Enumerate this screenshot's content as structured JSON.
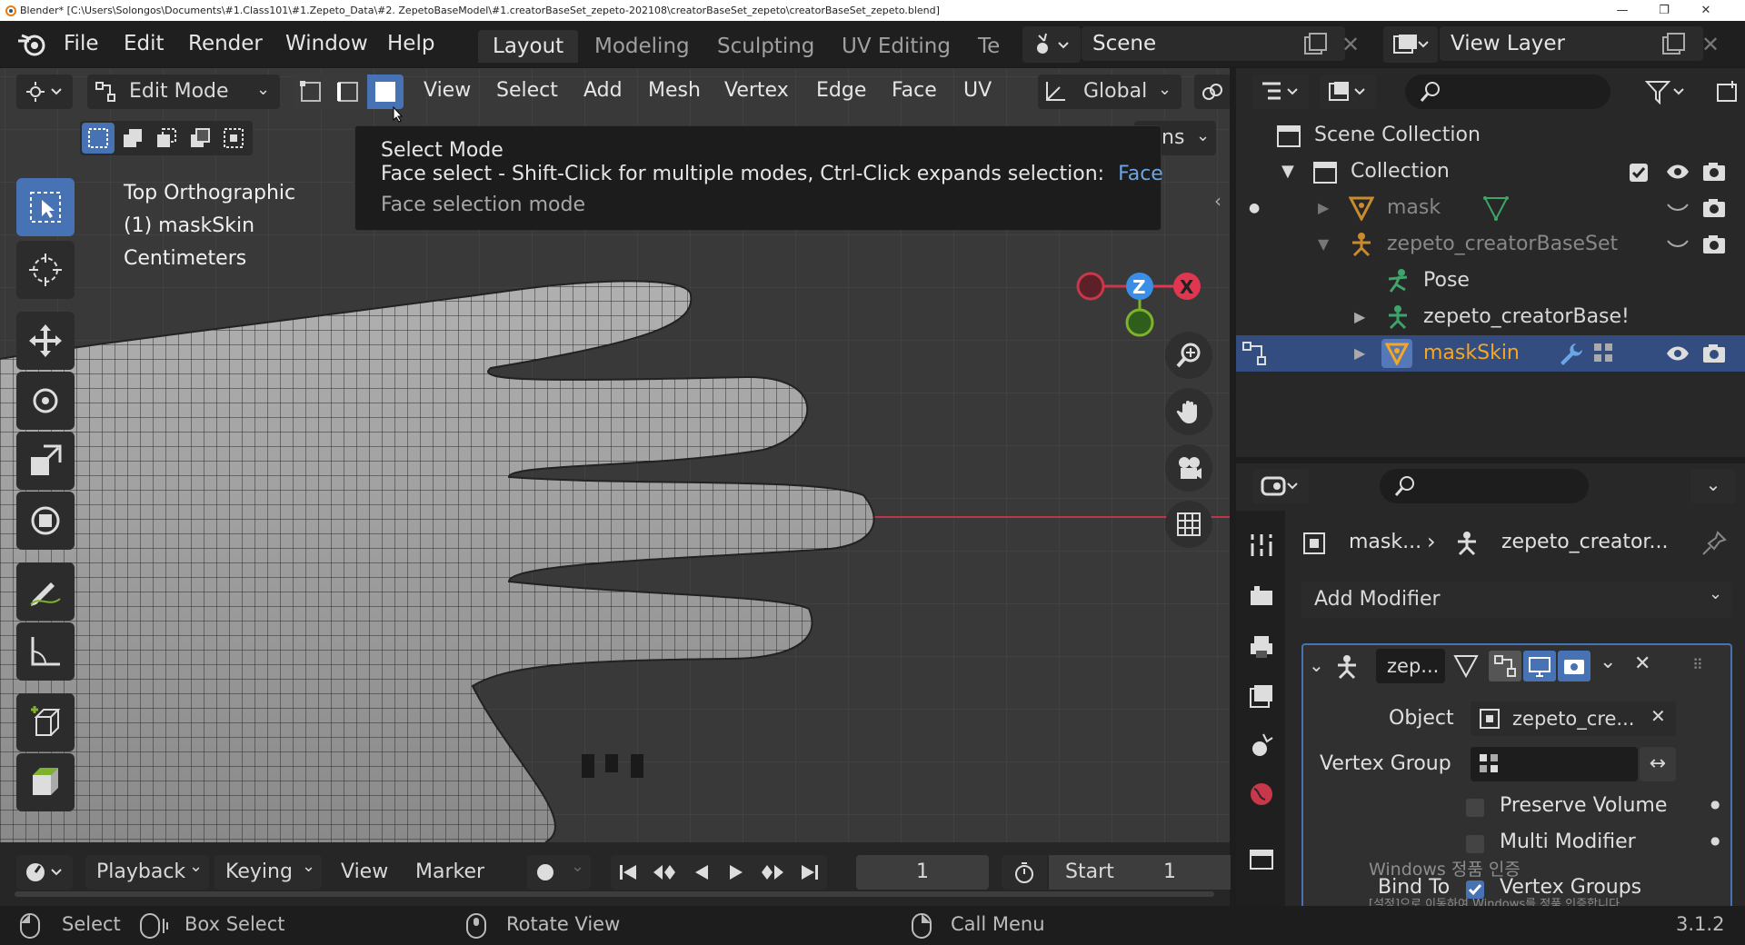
{
  "titlebar": {
    "title": "Blender* [C:\\Users\\Solongos\\Documents\\#1.Class101\\#1.Zepeto_Data\\#2. ZepetoBaseModel\\#1.creatorBaseSet_zepeto-202108\\creatorBaseSet_zepeto\\creatorBaseSet_zepeto.blend]"
  },
  "menu": {
    "file": "File",
    "edit": "Edit",
    "render": "Render",
    "window": "Window",
    "help": "Help"
  },
  "workspaces": [
    "Layout",
    "Modeling",
    "Sculpting",
    "UV Editing",
    "Te"
  ],
  "scene": {
    "label": "Scene"
  },
  "viewlayer": {
    "label": "View Layer"
  },
  "viewport_header": {
    "mode": "Edit Mode",
    "view": "View",
    "select": "Select",
    "add": "Add",
    "mesh": "Mesh",
    "vertex": "Vertex",
    "edge": "Edge",
    "face": "Face",
    "uv": "UV",
    "orientation": "Global",
    "options_partial": "ns"
  },
  "viewport_overlay": {
    "view_name": "Top Orthographic",
    "object": "(1) maskSkin",
    "units": "Centimeters"
  },
  "tooltip": {
    "title": "Select Mode",
    "line": "Face select - Shift-Click for multiple modes, Ctrl-Click expands selection:",
    "value": "Face",
    "desc": "Face selection mode"
  },
  "gizmo": {
    "z": "Z",
    "x": "X"
  },
  "timeline": {
    "playback": "Playback",
    "keying": "Keying",
    "view": "View",
    "marker": "Marker",
    "current_frame": "1",
    "start_label": "Start",
    "start_value": "1"
  },
  "outliner": {
    "scene_collection": "Scene Collection",
    "collection": "Collection",
    "rows": [
      {
        "name": "mask"
      },
      {
        "name": "zepeto_creatorBaseSet"
      },
      {
        "name": "Pose"
      },
      {
        "name": "zepeto_creatorBase!"
      },
      {
        "name": "maskSkin"
      }
    ]
  },
  "properties": {
    "breadcrumb_obj": "mask...",
    "breadcrumb_mod": "zepeto_creator...",
    "add_modifier": "Add Modifier",
    "modifier_name": "zep...",
    "object_label": "Object",
    "object_value": "zepeto_cre...",
    "vertex_group_label": "Vertex Group",
    "preserve_volume": "Preserve Volume",
    "multi_modifier": "Multi Modifier",
    "bind_to": "Bind To",
    "vertex_groups": "Vertex Groups",
    "watermark_1": "Windows 정품 인증",
    "watermark_2": "[설정]으로 이동하여 Windows를 정품 인증합니다."
  },
  "statusbar": {
    "select": "Select",
    "box_select": "Box Select",
    "rotate_view": "Rotate View",
    "call_menu": "Call Menu",
    "version": "3.1.2"
  },
  "colors": {
    "accent": "#4772b3",
    "axis_x": "#e0364f",
    "axis_y": "#7fb12a",
    "axis_z": "#3a8ee6",
    "object_active": "#f5a623",
    "tooltip_value": "#6aa5e6"
  }
}
